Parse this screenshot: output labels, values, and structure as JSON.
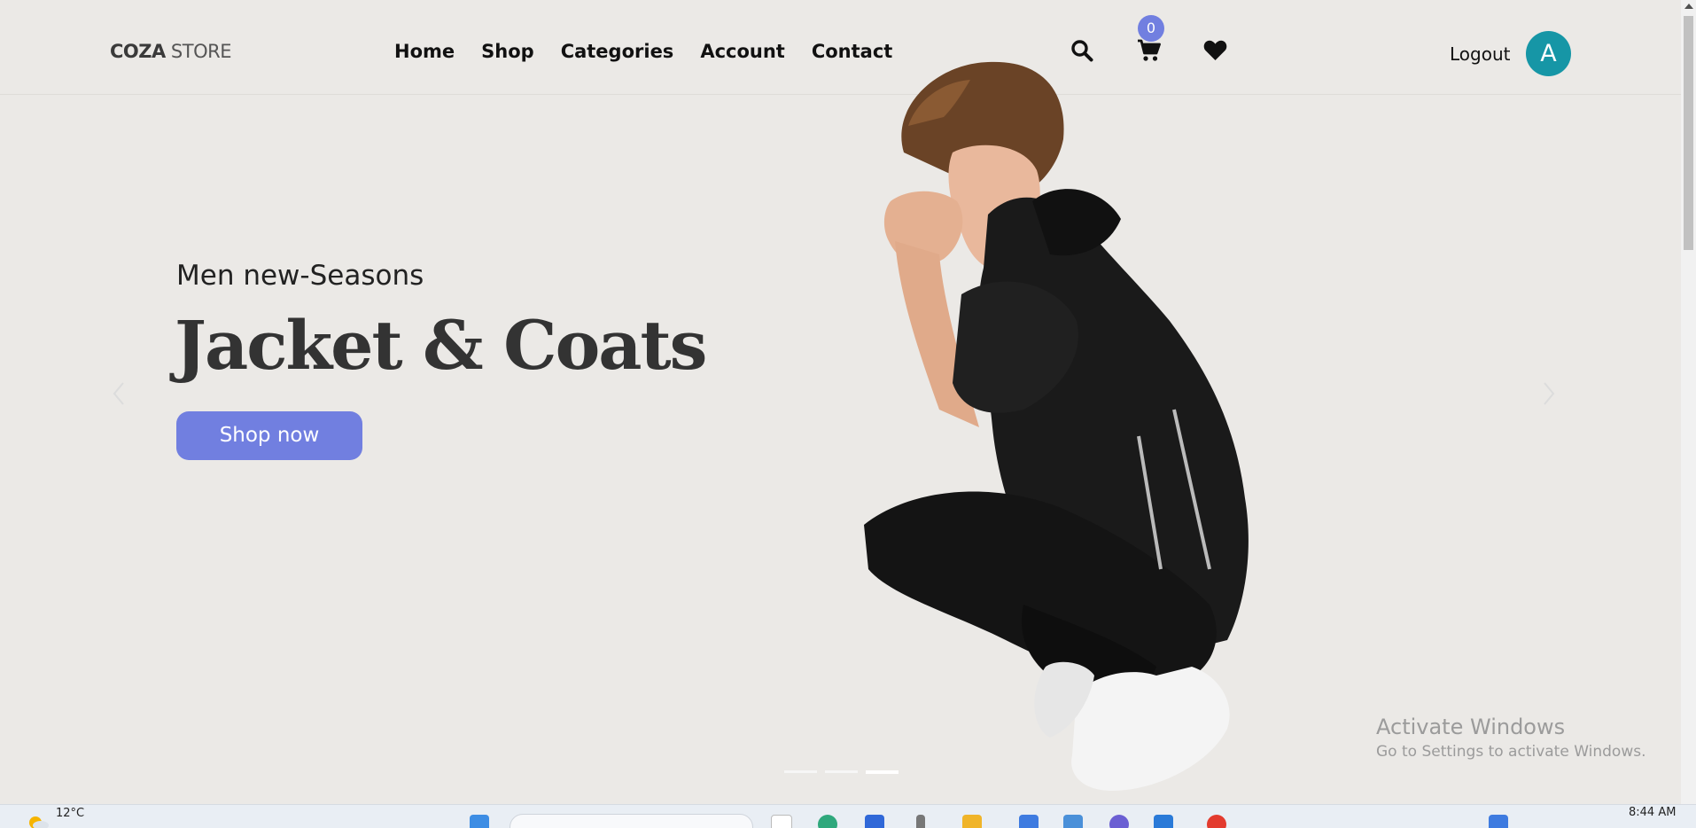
{
  "header": {
    "logo_bold": "COZA",
    "logo_rest": " STORE",
    "nav": [
      "Home",
      "Shop",
      "Categories",
      "Account",
      "Contact"
    ],
    "cart_count": "0",
    "logout_label": "Logout",
    "avatar_initial": "A",
    "icons": [
      "search-icon",
      "cart-icon",
      "heart-icon"
    ]
  },
  "hero": {
    "subtitle": "Men new-Seasons",
    "title": "Jacket & Coats",
    "button_label": "Shop now",
    "slides_count": 3,
    "active_slide": 3
  },
  "watermark": {
    "line1": "Activate Windows",
    "line2": "Go to Settings to activate Windows."
  },
  "taskbar": {
    "temperature": "12°C",
    "time": "8:44 AM"
  },
  "colors": {
    "background": "#ebe9e6",
    "accent": "#717fe0",
    "avatar": "#1696a6"
  }
}
